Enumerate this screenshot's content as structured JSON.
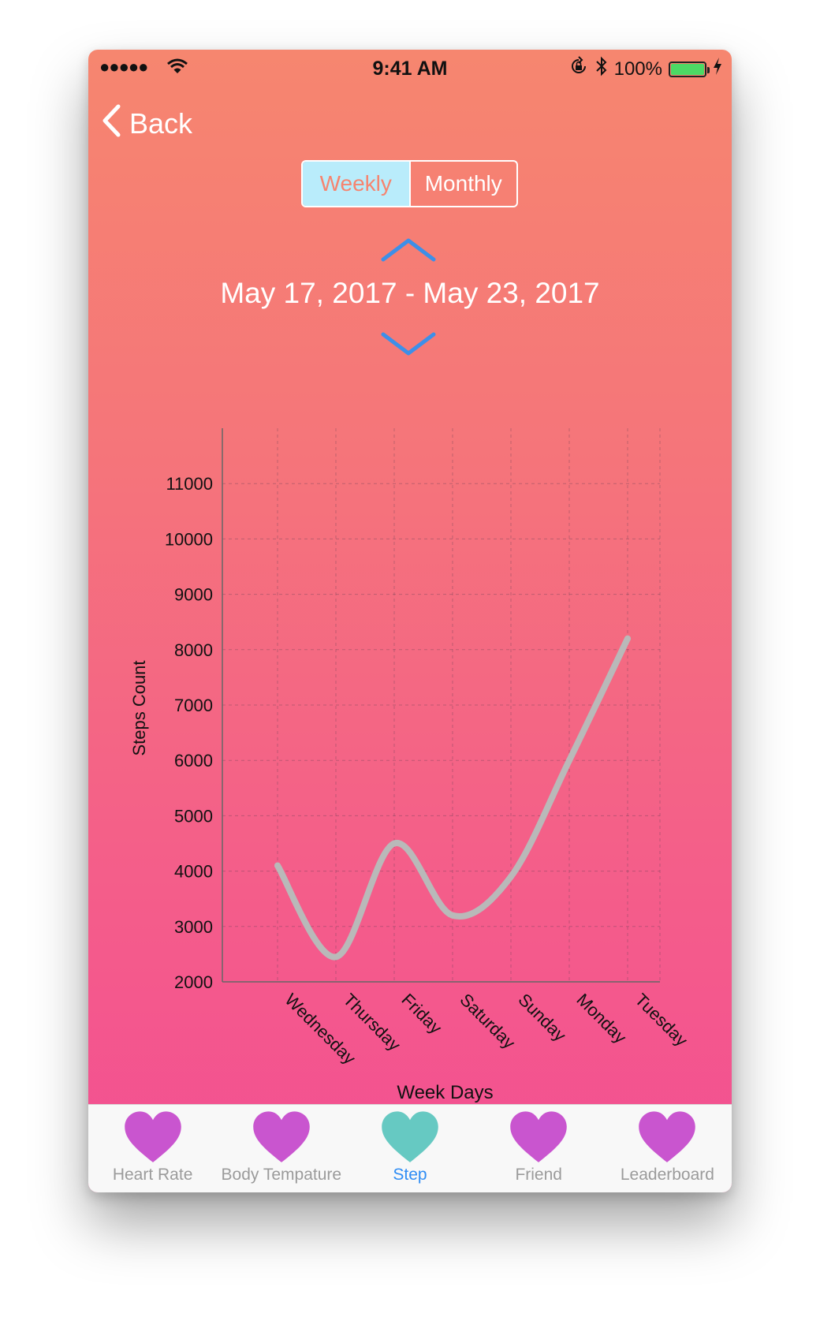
{
  "status_bar": {
    "signal": "●●●●●",
    "time": "9:41 AM",
    "battery_percent": "100%",
    "battery_level": 1.0,
    "icons": [
      "signal-dots-icon",
      "wifi-icon",
      "orientation-lock-icon",
      "bluetooth-icon",
      "battery-icon",
      "charging-bolt-icon"
    ]
  },
  "nav": {
    "back_label": "Back"
  },
  "period_toggle": {
    "options": [
      "Weekly",
      "Monthly"
    ],
    "selected": "Weekly"
  },
  "date_range": "May 17, 2017 - May 23, 2017",
  "colors": {
    "gradient_top": "#f6866f",
    "gradient_bottom": "#f34f92",
    "accent_blue": "#2f8df4",
    "heart_purple": "#c955cf",
    "heart_teal": "#66c9c2",
    "line_gray": "#b9b9b9",
    "segment_selected_bg": "#b9ecfb"
  },
  "chart_data": {
    "type": "line",
    "title": "",
    "xlabel": "Week Days",
    "ylabel": "Steps Count",
    "categories": [
      "Wednesday",
      "Thursday",
      "Friday",
      "Saturday",
      "Sunday",
      "Monday",
      "Tuesday"
    ],
    "values": [
      4100,
      2450,
      4500,
      3200,
      3900,
      6000,
      8200
    ],
    "y_ticks": [
      2000,
      3000,
      4000,
      5000,
      6000,
      7000,
      8000,
      9000,
      10000,
      11000
    ],
    "ylim": [
      2000,
      12000
    ],
    "grid": true,
    "smooth": true
  },
  "tabs": [
    {
      "label": "Heart Rate",
      "icon": "heart-icon",
      "active": false
    },
    {
      "label": "Body Tempature",
      "icon": "heart-icon",
      "active": false
    },
    {
      "label": "Step",
      "icon": "heart-icon",
      "active": true
    },
    {
      "label": "Friend",
      "icon": "heart-icon",
      "active": false
    },
    {
      "label": "Leaderboard",
      "icon": "heart-icon",
      "active": false
    }
  ]
}
